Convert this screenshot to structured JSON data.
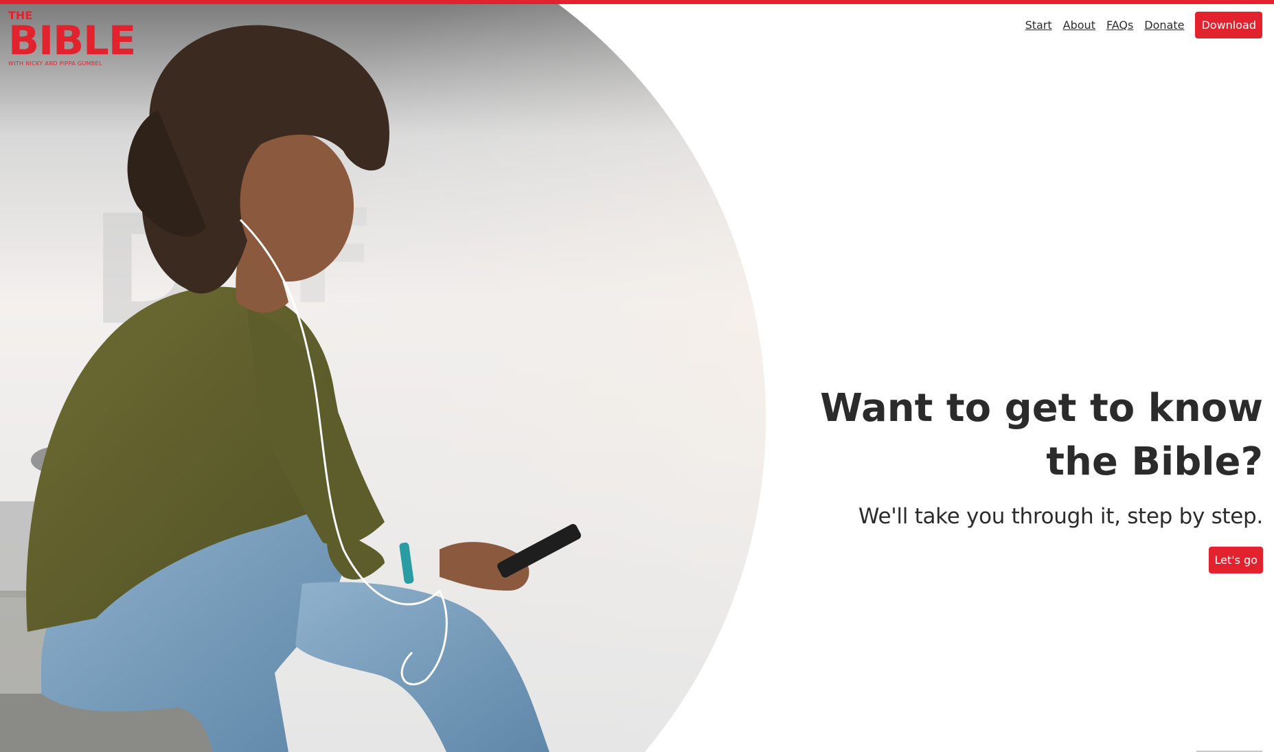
{
  "brand": {
    "logo_top": "THE",
    "logo_main": "BIBLE",
    "logo_tagline": "WITH NICKY AND PIPPA GUMBEL",
    "accent_color": "#e2222d"
  },
  "nav": {
    "items": [
      {
        "label": "Start"
      },
      {
        "label": "About"
      },
      {
        "label": "FAQs"
      },
      {
        "label": "Donate"
      }
    ],
    "download_label": "Download"
  },
  "hero": {
    "title_line1": "Want to get to know",
    "title_line2": "the Bible?",
    "subtitle": "We'll take you through it, step by step.",
    "cta_label": "Let's go",
    "image_icon": "woman-with-phone-photo"
  }
}
